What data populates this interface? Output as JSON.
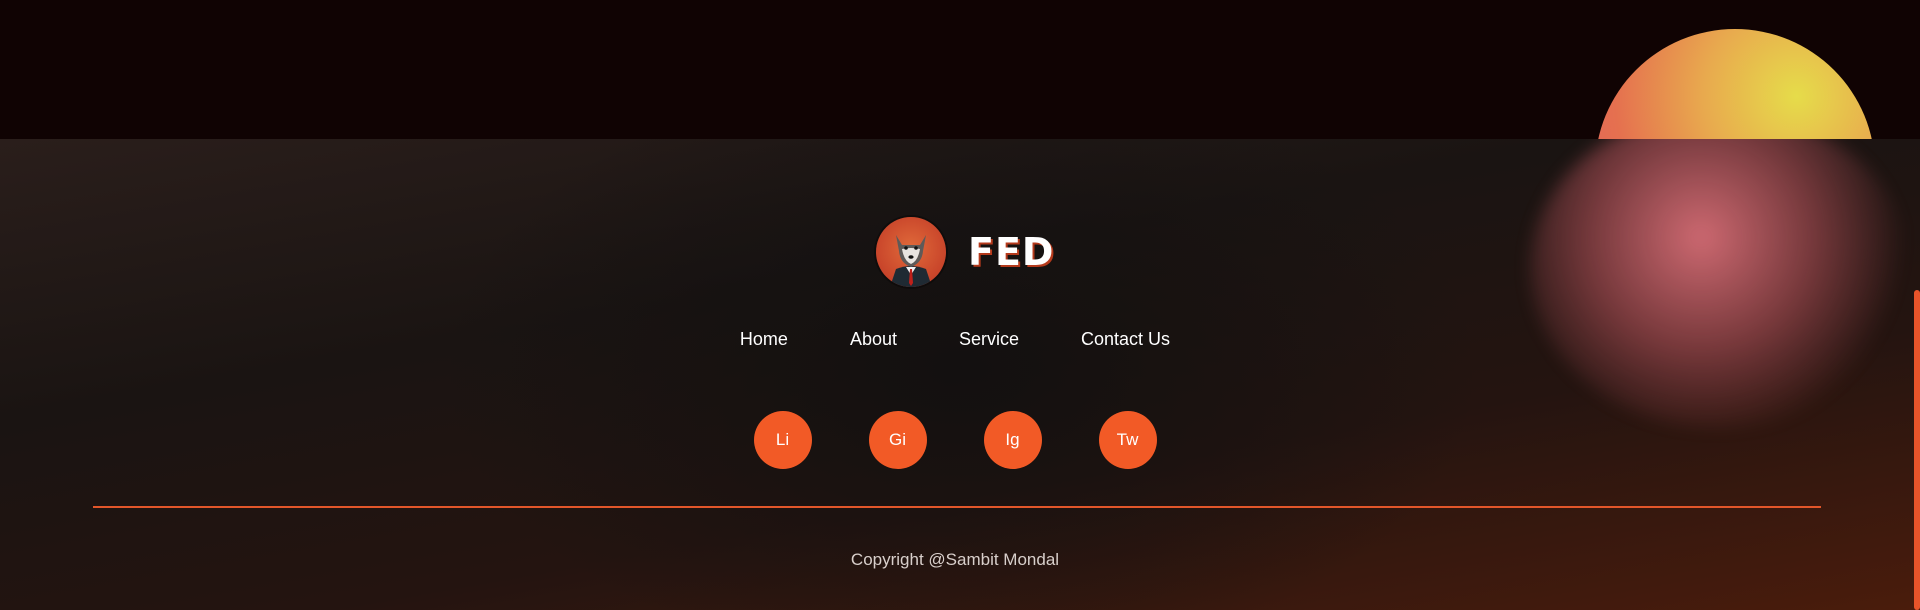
{
  "brand": {
    "name": "FED",
    "logo_icon": "wolf-in-suit-icon"
  },
  "nav": {
    "items": [
      {
        "label": "Home"
      },
      {
        "label": "About"
      },
      {
        "label": "Service"
      },
      {
        "label": "Contact Us"
      }
    ]
  },
  "social": {
    "buttons": [
      {
        "label": "Li",
        "icon": "linkedin-icon"
      },
      {
        "label": "Gi",
        "icon": "github-icon"
      },
      {
        "label": "Ig",
        "icon": "instagram-icon"
      },
      {
        "label": "Tw",
        "icon": "twitter-icon"
      }
    ]
  },
  "footer": {
    "copyright": "Copyright @Sambit Mondal"
  },
  "colors": {
    "accent": "#f25a26",
    "background": "#110404",
    "text": "#ffffff"
  }
}
